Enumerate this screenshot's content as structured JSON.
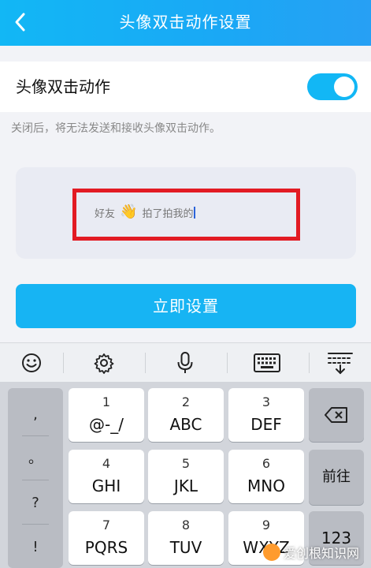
{
  "header": {
    "title": "头像双击动作设置"
  },
  "setting": {
    "label": "头像双击动作",
    "enabled": true,
    "accent": "#12b7f5"
  },
  "hint": "关闭后，将无法发送和接收头像双击动作。",
  "preview": {
    "friend": "好友",
    "icon": "waving-hand",
    "action": "拍了拍我的"
  },
  "button": {
    "label": "立即设置"
  },
  "toolbar": {
    "items": [
      "emoji-icon",
      "settings-icon",
      "microphone-icon",
      "keyboard-icon",
      "collapse-keyboard-icon"
    ]
  },
  "keyboard": {
    "side": [
      ",",
      "。",
      "?",
      "!"
    ],
    "keys": [
      {
        "num": "1",
        "letters": "@-_/"
      },
      {
        "num": "2",
        "letters": "ABC"
      },
      {
        "num": "3",
        "letters": "DEF"
      },
      {
        "num": "4",
        "letters": "GHI"
      },
      {
        "num": "5",
        "letters": "JKL"
      },
      {
        "num": "6",
        "letters": "MNO"
      },
      {
        "num": "7",
        "letters": "PQRS"
      },
      {
        "num": "8",
        "letters": "TUV"
      },
      {
        "num": "9",
        "letters": "WXYZ"
      }
    ],
    "backspace": "backspace-icon",
    "next_line": "前往",
    "num_switch": "123"
  },
  "watermark": "爱创根知识网"
}
